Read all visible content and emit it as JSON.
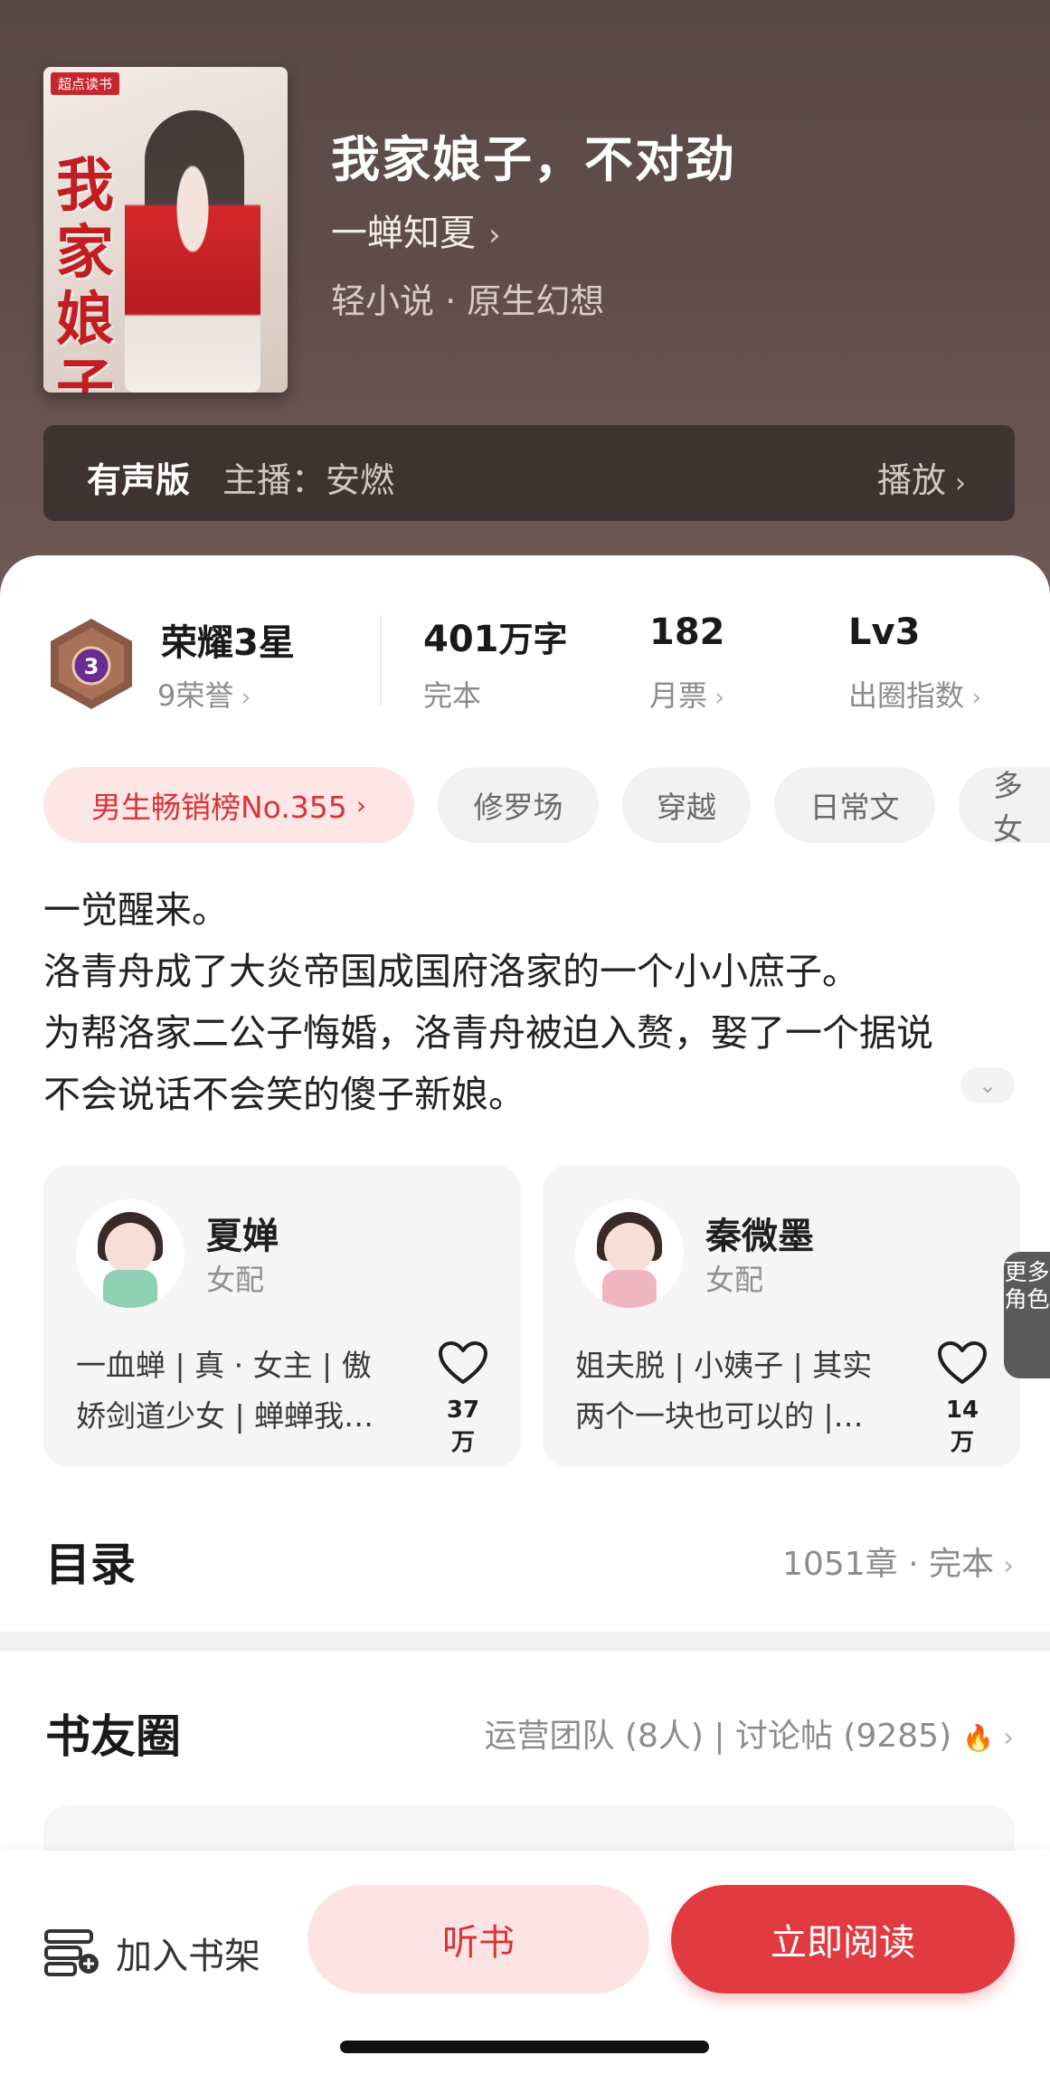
{
  "book": {
    "cover_brand": "超点读书",
    "cover_title": "我家娘子",
    "title": "我家娘子，不对劲",
    "author": "一蝉知夏",
    "genre": "轻小说 · 原生幻想"
  },
  "audio": {
    "label": "有声版",
    "host": "主播：安燃",
    "play": "播放"
  },
  "stats": {
    "honor_title": "荣耀3星",
    "honor_badge_num": "3",
    "honor_sub": "9荣誉",
    "words_num": "401",
    "words_unit": "万字",
    "words_sub": "完本",
    "tickets_num": "182",
    "tickets_sub": "月票",
    "level_num": "Lv3",
    "level_sub": "出圈指数"
  },
  "tags": [
    "男生畅销榜No.355",
    "修罗场",
    "穿越",
    "日常文",
    "多女"
  ],
  "synopsis": [
    "一觉醒来。",
    "洛青舟成了大炎帝国成国府洛家的一个小小庶子。",
    "为帮洛家二公子悔婚，洛青舟被迫入赘，娶了一个据说",
    "不会说话不会笑的傻子新娘。"
  ],
  "characters": [
    {
      "name": "夏婵",
      "role": "女配",
      "desc_line1": "一血蝉 | 真 · 女主 | 傲",
      "desc_line2": "娇剑道少女 | 蝉蝉我…",
      "likes": "37万",
      "color": "#8fd1b5"
    },
    {
      "name": "秦微墨",
      "role": "女配",
      "desc_line1": "姐夫脱 | 小姨子 | 其实",
      "desc_line2": "两个一块也可以的 |…",
      "likes": "14万",
      "color": "#f0b6c0"
    }
  ],
  "more_roles": "更多角色",
  "catalog": {
    "title": "目录",
    "info": "1051章 · 完本"
  },
  "community": {
    "title": "书友圈",
    "info": "运营团队 (8人) | 讨论帖 (9285)"
  },
  "bottom": {
    "shelf": "加入书架",
    "listen": "听书",
    "read": "立即阅读"
  },
  "colors": {
    "accent": "#e13b41",
    "rank_tag_bg": "#fde6e6",
    "hero_bg": "#5a4a47"
  }
}
